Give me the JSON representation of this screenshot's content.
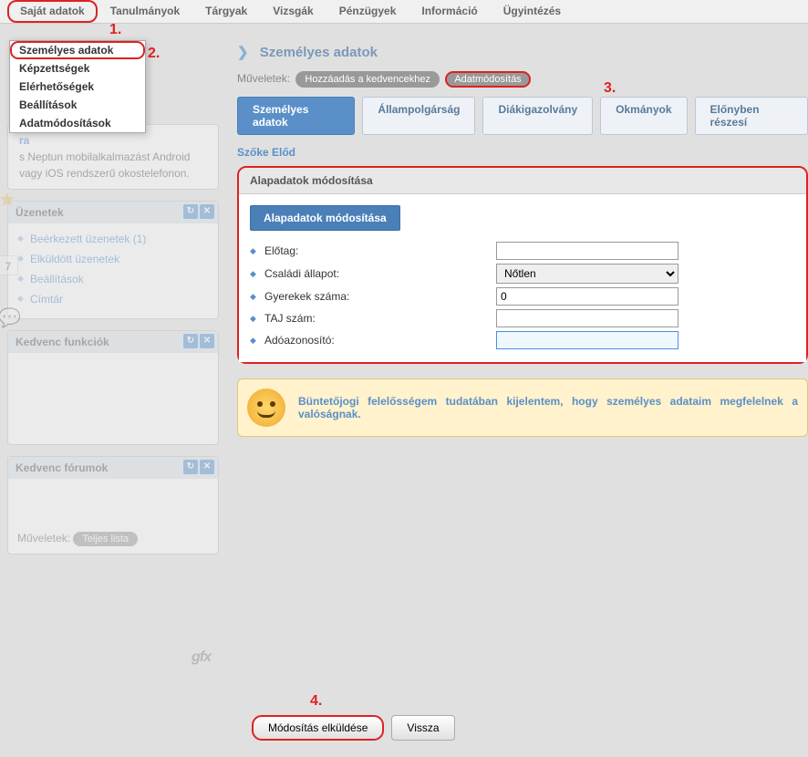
{
  "nav": {
    "items": [
      "Saját adatok",
      "Tanulmányok",
      "Tárgyak",
      "Vizsgák",
      "Pénzügyek",
      "Információ",
      "Ügyintézés"
    ]
  },
  "annotations": {
    "a1": "1.",
    "a2": "2.",
    "a3": "3.",
    "a4": "4."
  },
  "dropdown": {
    "items": [
      "Személyes adatok",
      "Képzettségek",
      "Elérhetőségek",
      "Beállítások",
      "Adatmódosítások"
    ]
  },
  "sidebar": {
    "phone_note": "s Neptun mobilalkalmazást Android vagy iOS rendszerű okostelefonon.",
    "phone_title": "ra",
    "messages_title": "Üzenetek",
    "messages_links": [
      "Beérkezett üzenetek (1)",
      "Elküldött üzenetek",
      "Beállítások",
      "Címtár"
    ],
    "fav_func_title": "Kedvenc funkciók",
    "fav_forum_title": "Kedvenc fórumok",
    "action_label": "Műveletek:",
    "action_btn": "Teljes lista",
    "cal_day": "7"
  },
  "content": {
    "breadcrumb": "Személyes adatok",
    "ops_label": "Műveletek:",
    "fav_btn": "Hozzáadás a kedvencekhez",
    "mod_btn": "Adatmódosítás",
    "tabs": [
      "Személyes adatok",
      "Állampolgárság",
      "Diákigazolvány",
      "Okmányok",
      "Előnyben részesí"
    ],
    "student": "Szőke Előd",
    "panel_title": "Alapadatok módosítása",
    "inner_tab": "Alapadatok módosítása",
    "form": {
      "prefix_label": "Előtag:",
      "prefix_value": "",
      "marital_label": "Családi állapot:",
      "marital_value": "Nőtlen",
      "children_label": "Gyerekek száma:",
      "children_value": "0",
      "taj_label": "TAJ szám:",
      "taj_value": "",
      "tax_label": "Adóazonosító:",
      "tax_value": ""
    },
    "notice": "Büntetőjogi felelősségem tudatában kijelentem, hogy személyes adataim megfelelnek a valóságnak."
  },
  "bottom": {
    "submit": "Módosítás elküldése",
    "back": "Vissza"
  },
  "footer_brand": "gfx"
}
